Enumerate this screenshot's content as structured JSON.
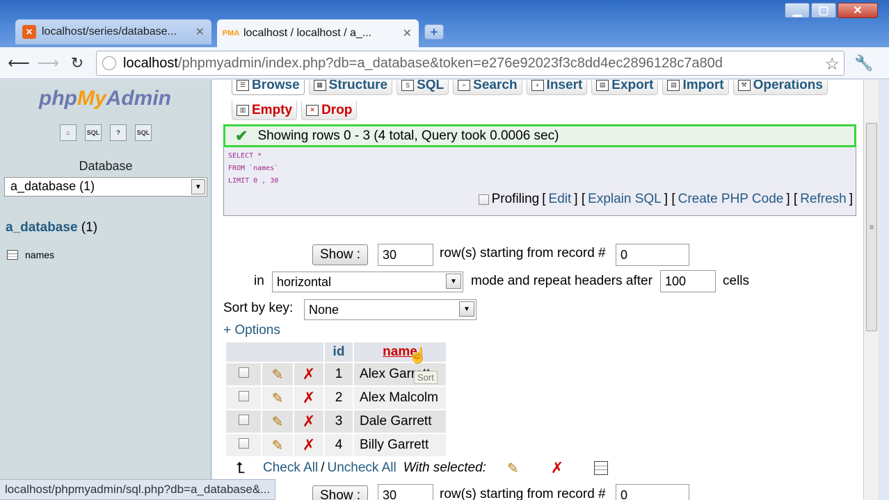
{
  "browser": {
    "tabs": [
      {
        "title": "localhost/series/database...",
        "active": false
      },
      {
        "title": "localhost / localhost / a_...",
        "active": true
      }
    ],
    "new_tab_label": "+",
    "url_host": "localhost",
    "url_path": "/phpmyadmin/index.php?db=a_database&token=e276e92023f3c8dd4ec2896128c7a80d",
    "status_bar": "localhost/phpmyadmin/sql.php?db=a_database&..."
  },
  "sidebar": {
    "logo": {
      "php": "php",
      "my": "My",
      "admin": "Admin"
    },
    "icons": [
      "home-icon",
      "sql-icon",
      "help-icon",
      "docs-icon"
    ],
    "database_label": "Database",
    "database_select": "a_database (1)",
    "database_link_name": "a_database",
    "database_link_count": "(1)",
    "tables": [
      {
        "name": "names"
      }
    ]
  },
  "menu": {
    "tabs": [
      "Browse",
      "Structure",
      "SQL",
      "Search",
      "Insert",
      "Export",
      "Import",
      "Operations"
    ],
    "tabs2": [
      "Empty",
      "Drop"
    ]
  },
  "result": {
    "message": "Showing rows 0 - 3 (4 total, Query took 0.0006 sec)",
    "sql_lines": [
      "SELECT *",
      "FROM `names`",
      "LIMIT 0 , 30"
    ],
    "profiling_label": "Profiling",
    "links": [
      "Edit",
      "Explain SQL",
      "Create PHP Code",
      "Refresh"
    ]
  },
  "nav_controls": {
    "show_button": "Show :",
    "rows_value": "30",
    "rows_label": "row(s) starting from record #",
    "start_value": "0",
    "in_label": "in",
    "mode_value": "horizontal",
    "mode_label": "mode and repeat headers after",
    "repeat_value": "100",
    "cells_label": "cells",
    "sort_label": "Sort by key:",
    "sort_value": "None",
    "options_link": "+ Options"
  },
  "table": {
    "headers": [
      "id",
      "name"
    ],
    "rows": [
      {
        "id": "1",
        "name": "Alex Garrett"
      },
      {
        "id": "2",
        "name": "Alex Malcolm"
      },
      {
        "id": "3",
        "name": "Dale Garrett"
      },
      {
        "id": "4",
        "name": "Billy Garrett"
      }
    ],
    "tooltip": "Sort"
  },
  "bulk": {
    "check_all": "Check All",
    "separator": "/",
    "uncheck_all": "Uncheck All",
    "with_selected": "With selected:"
  },
  "nav_controls_bottom": {
    "show_button": "Show :",
    "rows_value": "30",
    "rows_label": "row(s) starting from record #",
    "start_value": "0"
  },
  "colors": {
    "link": "#235a81",
    "success_border": "#3bd63b",
    "danger": "#cc0000",
    "logo_orange": "#f89c0e"
  }
}
